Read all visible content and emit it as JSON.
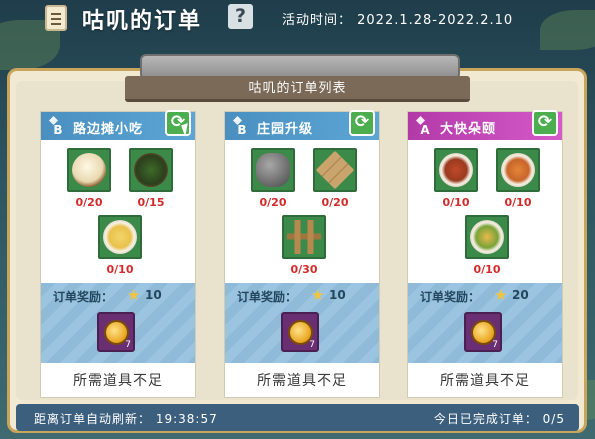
{
  "header": {
    "title": "咕叽的订单",
    "help_label": "?",
    "period": "活动时间： 2022.1.28-2022.2.10"
  },
  "board": {
    "sign_title": "咕叽的订单列表"
  },
  "cards": [
    {
      "grade": "B",
      "name": "路边摊小吃",
      "items": [
        {
          "icon": "egg-dish-icon",
          "count": "0/20"
        },
        {
          "icon": "fried-greens-icon",
          "count": "0/15"
        },
        {
          "icon": "noodle-dish-icon",
          "count": "0/10"
        }
      ],
      "reward_label": "订单奖励：",
      "stars": "10",
      "coin_qty": "7",
      "status": "所需道具不足"
    },
    {
      "grade": "B",
      "name": "庄园升级",
      "items": [
        {
          "icon": "stone-icon",
          "count": "0/20"
        },
        {
          "icon": "wood-plank-icon",
          "count": "0/20"
        },
        {
          "icon": "fence-post-icon",
          "count": "0/30"
        }
      ],
      "reward_label": "订单奖励：",
      "stars": "10",
      "coin_qty": "7",
      "status": "所需道具不足"
    },
    {
      "grade": "A",
      "name": "大快朵颐",
      "items": [
        {
          "icon": "roast-meat-icon",
          "count": "0/10"
        },
        {
          "icon": "fish-dish-icon",
          "count": "0/10"
        },
        {
          "icon": "salad-dish-icon",
          "count": "0/10"
        }
      ],
      "reward_label": "订单奖励：",
      "stars": "20",
      "coin_qty": "7",
      "status": "所需道具不足"
    }
  ],
  "footer": {
    "refresh_text": "距离订单自动刷新： 19:38:57",
    "completed_text": "今日已完成订单： 0/5"
  },
  "colors": {
    "grade_b": "#4a8fbf",
    "grade_a": "#b23aa8",
    "count_red": "#d22b2b",
    "refresh_green": "#4cae4f"
  }
}
